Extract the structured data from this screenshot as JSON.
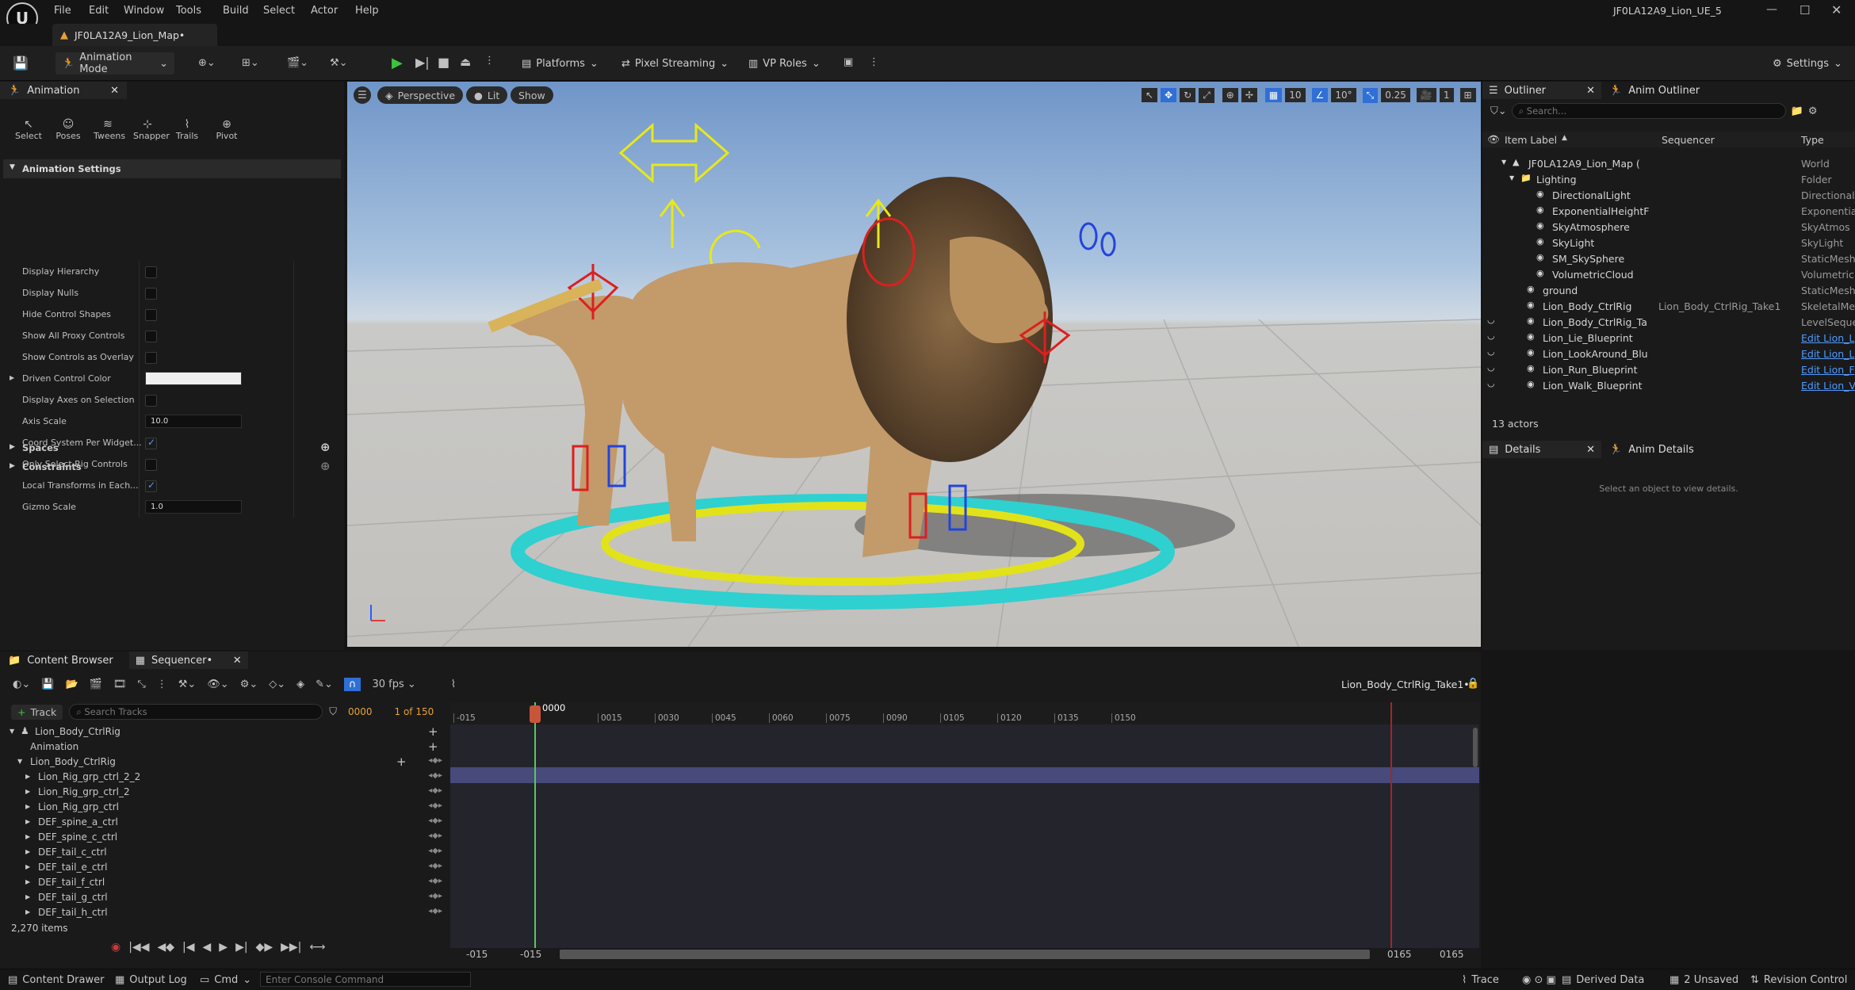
{
  "window": {
    "tab_title": "JF0LA12A9_Lion_Map•",
    "project": "JF0LA12A9_Lion_UE_5"
  },
  "menu": [
    "File",
    "Edit",
    "Window",
    "Tools",
    "Build",
    "Select",
    "Actor",
    "Help"
  ],
  "toolbar": {
    "mode": "Animation Mode",
    "platforms": "Platforms",
    "pixel_streaming": "Pixel Streaming",
    "vp_roles": "VP Roles",
    "settings": "Settings"
  },
  "anim_panel": {
    "tab": "Animation",
    "tools": [
      "Select",
      "Poses",
      "Tweens",
      "Snapper",
      "Trails",
      "Pivot"
    ],
    "section": "Animation Settings",
    "props": [
      {
        "label": "Display Hierarchy",
        "type": "check",
        "value": false
      },
      {
        "label": "Display Nulls",
        "type": "check",
        "value": false
      },
      {
        "label": "Hide Control Shapes",
        "type": "check",
        "value": false
      },
      {
        "label": "Show All Proxy Controls",
        "type": "check",
        "value": false
      },
      {
        "label": "Show Controls as Overlay",
        "type": "check",
        "value": false
      },
      {
        "label": "Driven Control Color",
        "type": "color",
        "value": ""
      },
      {
        "label": "Display Axes on Selection",
        "type": "check",
        "value": false
      },
      {
        "label": "Axis Scale",
        "type": "num",
        "value": "10.0"
      },
      {
        "label": "Coord System Per Widget...",
        "type": "check",
        "value": true
      },
      {
        "label": "Only Select Rig Controls",
        "type": "check",
        "value": false
      },
      {
        "label": "Local Transforms in Each...",
        "type": "check",
        "value": true
      },
      {
        "label": "Gizmo Scale",
        "type": "num",
        "value": "1.0"
      }
    ],
    "spaces": "Spaces",
    "constraints": "Constraints"
  },
  "viewport": {
    "perspective": "Perspective",
    "lit": "Lit",
    "show": "Show",
    "grid": "10",
    "angle": "10°",
    "scale": "0.25",
    "cams": "1"
  },
  "outliner": {
    "tab": "Outliner",
    "tab2": "Anim Outliner",
    "search": "Search...",
    "col_label": "Item Label",
    "col_seq": "Sequencer",
    "col_type": "Type",
    "rows": [
      {
        "name": "JF0LA12A9_Lion_Map (",
        "type": "World",
        "indent": 0,
        "seq": ""
      },
      {
        "name": "Lighting",
        "type": "Folder",
        "indent": 1,
        "seq": ""
      },
      {
        "name": "DirectionalLight",
        "type": "Directional",
        "indent": 2,
        "seq": ""
      },
      {
        "name": "ExponentialHeightF",
        "type": "Exponentia",
        "indent": 2,
        "seq": ""
      },
      {
        "name": "SkyAtmosphere",
        "type": "SkyAtmos",
        "indent": 2,
        "seq": ""
      },
      {
        "name": "SkyLight",
        "type": "SkyLight",
        "indent": 2,
        "seq": ""
      },
      {
        "name": "SM_SkySphere",
        "type": "StaticMesh",
        "indent": 2,
        "seq": ""
      },
      {
        "name": "VolumetricCloud",
        "type": "Volumetric",
        "indent": 2,
        "seq": ""
      },
      {
        "name": "ground",
        "type": "StaticMesh",
        "indent": 1,
        "seq": ""
      },
      {
        "name": "Lion_Body_CtrlRig",
        "type": "SkeletalMe",
        "indent": 1,
        "seq": "Lion_Body_CtrlRig_Take1"
      },
      {
        "name": "Lion_Body_CtrlRig_Ta",
        "type": "LevelSeque",
        "indent": 1,
        "seq": ""
      },
      {
        "name": "Lion_Lie_Blueprint",
        "type": "Edit Lion_L",
        "indent": 1,
        "seq": "",
        "link": true
      },
      {
        "name": "Lion_LookAround_Blu",
        "type": "Edit Lion_L",
        "indent": 1,
        "seq": "",
        "link": true
      },
      {
        "name": "Lion_Run_Blueprint",
        "type": "Edit Lion_F",
        "indent": 1,
        "seq": "",
        "link": true
      },
      {
        "name": "Lion_Walk_Blueprint",
        "type": "Edit Lion_V",
        "indent": 1,
        "seq": "",
        "link": true
      }
    ],
    "count": "13 actors"
  },
  "details": {
    "tab": "Details",
    "tab2": "Anim Details",
    "empty": "Select an object to view details."
  },
  "bottom_tabs": {
    "content": "Content Browser",
    "sequencer": "Sequencer•"
  },
  "sequencer": {
    "fps": "30 fps",
    "seq_name": "Lion_Body_CtrlRig_Take1•",
    "track_btn": "Track",
    "search": "Search Tracks",
    "frame": "0000",
    "of": "1 of 150",
    "playhead": "0000",
    "ticks": [
      "-015",
      "0015",
      "0030",
      "0045",
      "0060",
      "0075",
      "0090",
      "0105",
      "0120",
      "0135",
      "0150"
    ],
    "tracks": [
      {
        "name": "Lion_Body_CtrlRig",
        "indent": 30,
        "kind": "root"
      },
      {
        "name": "Animation",
        "indent": 38,
        "kind": "sub"
      },
      {
        "name": "Lion_Body_CtrlRig",
        "indent": 38,
        "kind": "rig"
      },
      {
        "name": "Lion_Rig_grp_ctrl_2_2",
        "indent": 48,
        "kind": "ctrl"
      },
      {
        "name": "Lion_Rig_grp_ctrl_2",
        "indent": 48,
        "kind": "ctrl"
      },
      {
        "name": "Lion_Rig_grp_ctrl",
        "indent": 48,
        "kind": "ctrl"
      },
      {
        "name": "DEF_spine_a_ctrl",
        "indent": 48,
        "kind": "ctrl"
      },
      {
        "name": "DEF_spine_c_ctrl",
        "indent": 48,
        "kind": "ctrl"
      },
      {
        "name": "DEF_tail_c_ctrl",
        "indent": 48,
        "kind": "ctrl"
      },
      {
        "name": "DEF_tail_e_ctrl",
        "indent": 48,
        "kind": "ctrl"
      },
      {
        "name": "DEF_tail_f_ctrl",
        "indent": 48,
        "kind": "ctrl"
      },
      {
        "name": "DEF_tail_g_ctrl",
        "indent": 48,
        "kind": "ctrl"
      },
      {
        "name": "DEF_tail_h_ctrl",
        "indent": 48,
        "kind": "ctrl"
      }
    ],
    "items": "2,270 items",
    "range": [
      "-015",
      "-015",
      "0165",
      "0165"
    ]
  },
  "status": {
    "content_drawer": "Content Drawer",
    "output": "Output Log",
    "cmd": "Cmd",
    "console": "Enter Console Command",
    "trace": "Trace",
    "derived": "Derived Data",
    "unsaved": "2 Unsaved",
    "revision": "Revision Control"
  }
}
